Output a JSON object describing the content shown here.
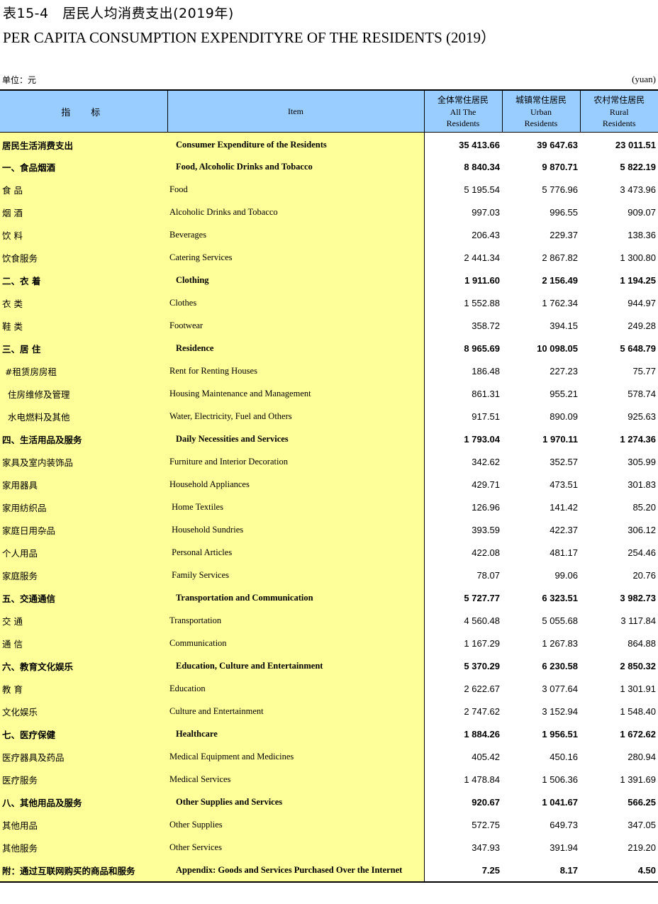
{
  "title": {
    "cn": "表15-4　居民人均消费支出(2019年)",
    "en": "PER CAPITA CONSUMPTION EXPENDITYRE OF THE RESIDENTS (2019）"
  },
  "unit": {
    "cn": "单位：元",
    "en": "(yuan)"
  },
  "header": {
    "indicator_cn": "指　标",
    "item_en": "Item",
    "columns": [
      {
        "cn": "全体常住居民",
        "en1": "All The",
        "en2": "Residents"
      },
      {
        "cn": "城镇常住居民",
        "en1": "Urban",
        "en2": "Residents"
      },
      {
        "cn": "农村常住居民",
        "en1": "Rural",
        "en2": "Residents"
      }
    ]
  },
  "rows": [
    {
      "cn": "居民生活消费支出",
      "en": "Consumer Expenditure of the Residents",
      "all": "35 413.66",
      "urban": "39 647.63",
      "rural": "23 011.51",
      "bold": true
    },
    {
      "cn": "一、食品烟酒",
      "en": "Food, Alcoholic Drinks and Tobacco",
      "all": "8 840.34",
      "urban": "9 870.71",
      "rural": "5 822.19",
      "bold": true
    },
    {
      "cn": "食 品",
      "en": "Food",
      "all": "5 195.54",
      "urban": "5 776.96",
      "rural": "3 473.96",
      "bold": false
    },
    {
      "cn": "烟 酒",
      "en": "Alcoholic Drinks and Tobacco",
      "all": "997.03",
      "urban": "996.55",
      "rural": "909.07",
      "bold": false
    },
    {
      "cn": "饮 料",
      "en": "Beverages",
      "all": "206.43",
      "urban": "229.37",
      "rural": "138.36",
      "bold": false
    },
    {
      "cn": "饮食服务",
      "en": "Catering Services",
      "all": "2 441.34",
      "urban": "2 867.82",
      "rural": "1 300.80",
      "bold": false
    },
    {
      "cn": "二、衣 着",
      "en": "Clothing",
      "all": "1 911.60",
      "urban": "2 156.49",
      "rural": "1 194.25",
      "bold": true
    },
    {
      "cn": "衣 类",
      "en": "Clothes",
      "all": "1 552.88",
      "urban": "1 762.34",
      "rural": "944.97",
      "bold": false
    },
    {
      "cn": "鞋 类",
      "en": "Footwear",
      "all": "358.72",
      "urban": "394.15",
      "rural": "249.28",
      "bold": false
    },
    {
      "cn": "三、居 住",
      "en": "Residence",
      "all": "8 965.69",
      "urban": "10 098.05",
      "rural": "5 648.79",
      "bold": true
    },
    {
      "cn": " #租赁房房租",
      "en": "Rent for Renting Houses",
      "all": "186.48",
      "urban": "227.23",
      "rural": "75.77",
      "bold": false
    },
    {
      "cn": "  住房维修及管理",
      "en": "Housing Maintenance and Management",
      "all": "861.31",
      "urban": "955.21",
      "rural": "578.74",
      "bold": false
    },
    {
      "cn": "  水电燃料及其他",
      "en": "Water, Electricity, Fuel and Others",
      "all": "917.51",
      "urban": "890.09",
      "rural": "925.63",
      "bold": false
    },
    {
      "cn": "四、生活用品及服务",
      "en": "Daily Necessities and Services",
      "all": "1 793.04",
      "urban": "1 970.11",
      "rural": "1 274.36",
      "bold": true
    },
    {
      "cn": "家具及室内装饰品",
      "en": "Furniture and Interior Decoration",
      "all": "342.62",
      "urban": "352.57",
      "rural": "305.99",
      "bold": false
    },
    {
      "cn": "家用器具",
      "en": "Household Appliances",
      "all": "429.71",
      "urban": "473.51",
      "rural": "301.83",
      "bold": false
    },
    {
      "cn": "家用纺织品",
      "en": " Home Textiles",
      "all": "126.96",
      "urban": "141.42",
      "rural": "85.20",
      "bold": false
    },
    {
      "cn": "家庭日用杂品",
      "en": " Household Sundries",
      "all": "393.59",
      "urban": "422.37",
      "rural": "306.12",
      "bold": false
    },
    {
      "cn": "个人用品",
      "en": " Personal Articles",
      "all": "422.08",
      "urban": "481.17",
      "rural": "254.46",
      "bold": false
    },
    {
      "cn": "家庭服务",
      "en": " Family Services",
      "all": "78.07",
      "urban": "99.06",
      "rural": "20.76",
      "bold": false
    },
    {
      "cn": "五、交通通信",
      "en": "Transportation and Communication",
      "all": "5 727.77",
      "urban": "6 323.51",
      "rural": "3 982.73",
      "bold": true
    },
    {
      "cn": "交 通",
      "en": "Transportation",
      "all": "4 560.48",
      "urban": "5 055.68",
      "rural": "3 117.84",
      "bold": false
    },
    {
      "cn": "通 信",
      "en": "Communication",
      "all": "1 167.29",
      "urban": "1 267.83",
      "rural": "864.88",
      "bold": false
    },
    {
      "cn": "六、教育文化娱乐",
      "en": "Education, Culture and Entertainment",
      "all": "5 370.29",
      "urban": "6 230.58",
      "rural": "2 850.32",
      "bold": true
    },
    {
      "cn": "教 育",
      "en": "Education",
      "all": "2 622.67",
      "urban": "3 077.64",
      "rural": "1 301.91",
      "bold": false
    },
    {
      "cn": "文化娱乐",
      "en": "Culture and Entertainment",
      "all": "2 747.62",
      "urban": "3 152.94",
      "rural": "1 548.40",
      "bold": false
    },
    {
      "cn": "七、医疗保健",
      "en": "Healthcare",
      "all": "1 884.26",
      "urban": "1 956.51",
      "rural": "1 672.62",
      "bold": true
    },
    {
      "cn": "医疗器具及药品",
      "en": "Medical Equipment and Medicines",
      "all": "405.42",
      "urban": "450.16",
      "rural": "280.94",
      "bold": false
    },
    {
      "cn": "医疗服务",
      "en": "Medical Services",
      "all": "1 478.84",
      "urban": "1 506.36",
      "rural": "1 391.69",
      "bold": false
    },
    {
      "cn": "八、其他用品及服务",
      "en": "Other Supplies and Services",
      "all": "920.67",
      "urban": "1 041.67",
      "rural": "566.25",
      "bold": true
    },
    {
      "cn": "其他用品",
      "en": "Other Supplies",
      "all": "572.75",
      "urban": "649.73",
      "rural": "347.05",
      "bold": false
    },
    {
      "cn": "其他服务",
      "en": "Other Services",
      "all": "347.93",
      "urban": "391.94",
      "rural": "219.20",
      "bold": false
    },
    {
      "cn": "附：通过互联网购买的商品和服务",
      "en": "Appendix: Goods and Services Purchased Over the Internet",
      "all": "7.25",
      "urban": "8.17",
      "rural": "4.50",
      "bold": true
    }
  ]
}
